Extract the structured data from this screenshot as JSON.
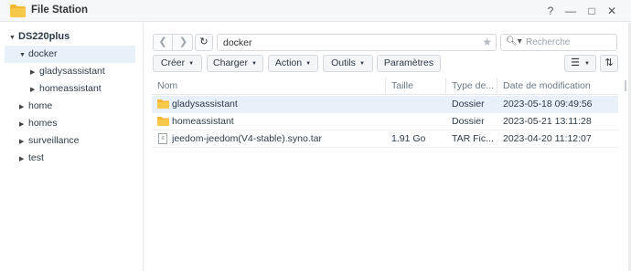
{
  "window": {
    "title": "File Station",
    "help_label": "?",
    "minimize_label": "—",
    "maximize_label": "□",
    "close_label": "✕"
  },
  "sidebar": {
    "root": "DS220plus",
    "items": [
      {
        "label": "docker"
      },
      {
        "label": "gladysassistant"
      },
      {
        "label": "homeassistant"
      },
      {
        "label": "home"
      },
      {
        "label": "homes"
      },
      {
        "label": "surveillance"
      },
      {
        "label": "test"
      }
    ]
  },
  "toolbar": {
    "path": "docker",
    "search_placeholder": "Recherche",
    "create_label": "Créer",
    "upload_label": "Charger",
    "action_label": "Action",
    "tools_label": "Outils",
    "settings_label": "Paramètres"
  },
  "table": {
    "columns": [
      "Nom",
      "Taille",
      "Type de...",
      "Date de modification"
    ],
    "rows": [
      {
        "name": "gladysassistant",
        "size": "",
        "type": "Dossier",
        "date": "2023-05-18 09:49:56",
        "icon": "folder-icon"
      },
      {
        "name": "homeassistant",
        "size": "",
        "type": "Dossier",
        "date": "2023-05-21 13:11:28",
        "icon": "folder-icon"
      },
      {
        "name": "jeedom-jeedom(V4-stable).syno.tar",
        "size": "1.91 Go",
        "type": "TAR Fic...",
        "date": "2023-04-20 11:12:07",
        "icon": "file-icon"
      }
    ]
  },
  "colors": {
    "accent": "#f4b400",
    "selection": "#e8f0fa"
  }
}
